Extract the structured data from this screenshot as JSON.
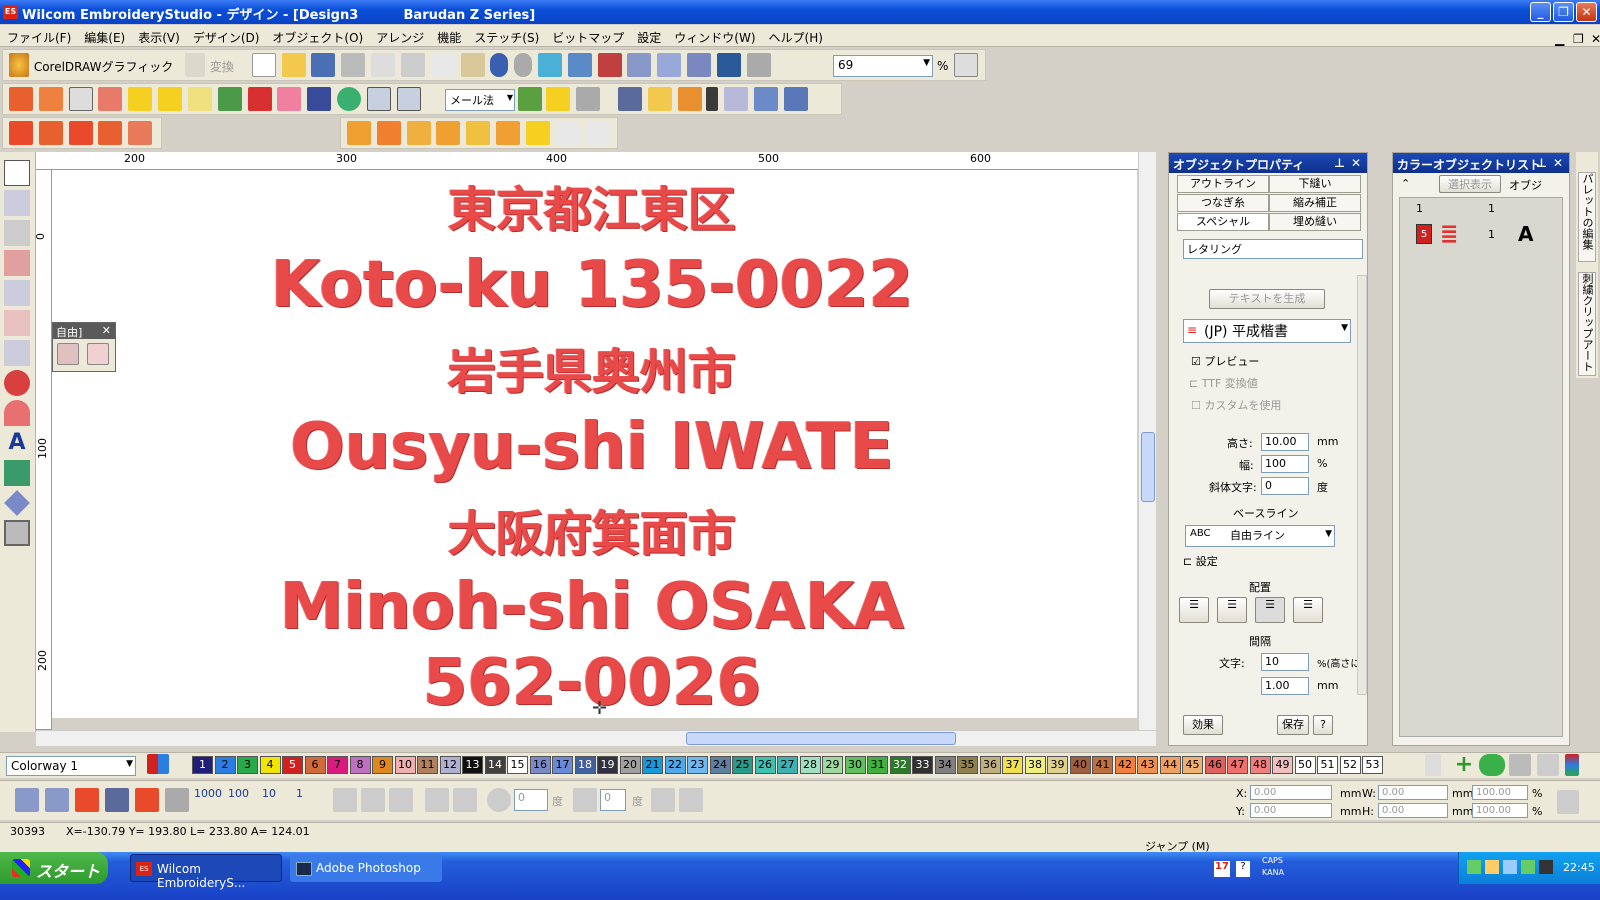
{
  "window": {
    "title": "Wilcom EmbroideryStudio - デザイン - [Design3          Barudan Z Series]",
    "logo": "ES"
  },
  "menu": [
    "ファイル(F)",
    "編集(E)",
    "表示(V)",
    "デザイン(D)",
    "オブジェクト(O)",
    "アレンジ",
    "機能",
    "ステッチ(S)",
    "ビットマップ",
    "設定",
    "ウィンドウ(W)",
    "ヘルプ(H)"
  ],
  "toolbar": {
    "corel_label": "CorelDRAWグラフィック",
    "convert_label": "変換",
    "zoom_value": "69",
    "zoom_unit": "%",
    "method_combo": "メール法"
  },
  "ruler": {
    "top_ticks": [
      "200",
      "300",
      "400",
      "500",
      "600"
    ],
    "left_ticks": [
      "0",
      "100",
      "200"
    ]
  },
  "float_palette": {
    "title": "自由]"
  },
  "design_lines": [
    "東京都江東区",
    "Koto-ku  135-0022",
    "岩手県奥州市",
    "Ousyu-shi  IWATE",
    "大阪府箕面市",
    "Minoh-shi  OSAKA",
    "562-0026"
  ],
  "object_properties": {
    "title": "オブジェクトプロパティ",
    "tabs": [
      "アウトライン",
      "下縫い",
      "つなぎ糸",
      "縮み補正",
      "スペシャル",
      "埋め縫い"
    ],
    "type_value": "レタリング",
    "generate_text_button": "テキストを生成",
    "font_value": "(JP) 平成楷書",
    "preview_label": "プレビュー",
    "ttf_label": "TTF 変換値",
    "custom_label": "カスタムを使用",
    "height_label": "高さ:",
    "height_value": "10.00",
    "height_unit": "mm",
    "width_label": "幅:",
    "width_value": "100",
    "width_unit": "%",
    "slant_label": "斜体文字:",
    "slant_value": "0",
    "slant_unit": "度",
    "baseline_label": "ベースライン",
    "baseline_value": "自由ライン",
    "baseline_icon_text": "ABC",
    "settings_label": "設定",
    "align_label": "配置",
    "spacing_label": "間隔",
    "char_label": "文字:",
    "char_value": "10",
    "char_unit": "%(高さに",
    "char_value2": "1.00",
    "char_unit2": "mm",
    "effect_button": "効果",
    "save_button": "保存",
    "help_button": "?"
  },
  "color_object_list": {
    "title": "カラーオブジェクトリスト",
    "filter_label": "選択表示",
    "col_label": "オブジ",
    "header_num1": "1",
    "header_num2": "1",
    "row_color_num": "5",
    "row_count": "1",
    "row_type": "A"
  },
  "side_tabs": [
    "パレットの編集",
    "刺繍クリップアート"
  ],
  "colorway": {
    "value": "Colorway 1"
  },
  "palette": [
    "1",
    "2",
    "3",
    "4",
    "5",
    "6",
    "7",
    "8",
    "9",
    "10",
    "11",
    "12",
    "13",
    "14",
    "15",
    "16",
    "17",
    "18",
    "19",
    "20",
    "21",
    "22",
    "23",
    "24",
    "25",
    "26",
    "27",
    "28",
    "29",
    "30",
    "31",
    "32",
    "33",
    "34",
    "35",
    "36",
    "37",
    "38",
    "39",
    "40",
    "41",
    "42",
    "43",
    "44",
    "45",
    "46",
    "47",
    "48",
    "49",
    "50",
    "51",
    "52",
    "53"
  ],
  "palette_colors": [
    "#1f1f7a",
    "#2a7de1",
    "#2aa84a",
    "#f2e600",
    "#d12020",
    "#d06a3a",
    "#d81b7c",
    "#c070c0",
    "#e08820",
    "#f0b0b0",
    "#b08060",
    "#b0b0d0",
    "#101010",
    "#404040",
    "#ffffff",
    "#7a8ac8",
    "#6a8ad8",
    "#4060a0",
    "#303040",
    "#a0a0a0",
    "#1a98d8",
    "#50a8e8",
    "#70b8f0",
    "#6080a0",
    "#2a9a8a",
    "#40c0b0",
    "#40b0b0",
    "#a0e0c0",
    "#a0d8a0",
    "#60c060",
    "#40b040",
    "#2a7a2a",
    "#303030",
    "#808080",
    "#908050",
    "#c0b080",
    "#f0e050",
    "#f0f080",
    "#e0d090",
    "#a06040",
    "#c07040",
    "#f08040",
    "#f09050",
    "#f0a060",
    "#f0b070",
    "#e06060",
    "#f07070",
    "#f08080",
    "#f0c0c0"
  ],
  "stitch_counts": [
    "1000",
    "100",
    "10",
    "1"
  ],
  "coords": {
    "x_label": "X:",
    "x_value": "0.00",
    "y_label": "Y:",
    "y_value": "0.00",
    "w_label": "W:",
    "w_value": "0.00",
    "h_label": "H:",
    "h_value": "0.00",
    "unit_mm": "mm",
    "w_pct": "100.00",
    "h_pct": "100.00",
    "pct": "%"
  },
  "angle_fields": {
    "a1": "0",
    "unit1": "度",
    "a2": "0",
    "unit2": "度"
  },
  "status": {
    "count": "30393",
    "coords": "X=-130.79  Y= 193.80  L= 233.80  A= 124.01",
    "jump": "ジャンプ (M)"
  },
  "taskbar": {
    "start_label": "スタート",
    "task1": "Wilcom EmbroideryS...",
    "task2": "Adobe Photoshop",
    "time": "22:45",
    "caps": "CAPS",
    "kana": "KANA",
    "ime": "17"
  }
}
